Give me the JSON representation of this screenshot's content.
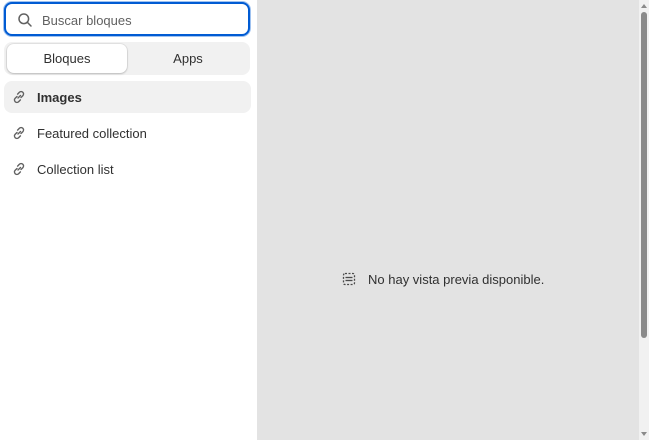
{
  "search": {
    "placeholder": "Buscar bloques",
    "icon": "search-icon"
  },
  "tabs": [
    {
      "label": "Bloques",
      "active": true
    },
    {
      "label": "Apps",
      "active": false
    }
  ],
  "blocks": [
    {
      "label": "Images",
      "icon": "link-icon",
      "selected": true
    },
    {
      "label": "Featured collection",
      "icon": "link-icon",
      "selected": false
    },
    {
      "label": "Collection list",
      "icon": "link-icon",
      "selected": false
    }
  ],
  "preview": {
    "empty_message": "No hay vista previa disponible.",
    "icon": "layout-empty-icon"
  },
  "colors": {
    "focus_border": "#005bd3",
    "preview_background": "#e3e3e3",
    "selected_background": "#f1f1f1",
    "text": "#303030"
  }
}
